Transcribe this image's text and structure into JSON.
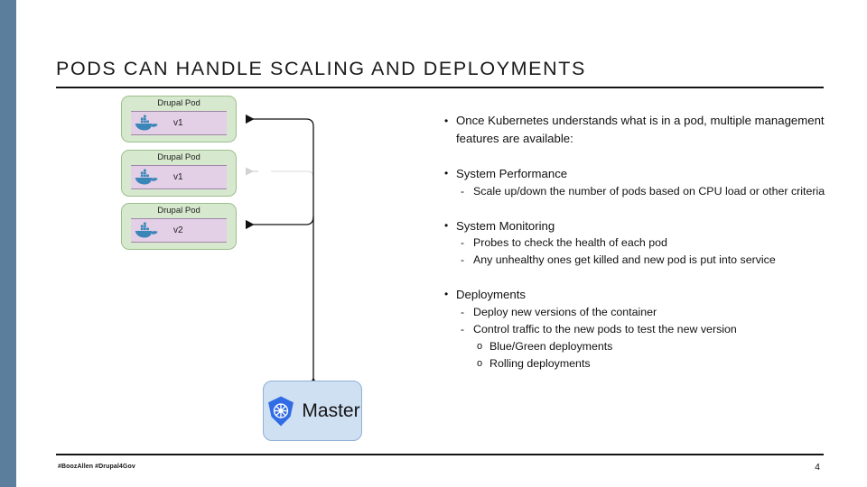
{
  "slide": {
    "title": "PODS CAN HANDLE SCALING AND DEPLOYMENTS",
    "accent_color": "#5b7e9c",
    "page_number": "4",
    "footer": "#BoozAllen #Drupal4Gov"
  },
  "diagram": {
    "pods": [
      {
        "title": "Drupal Pod",
        "version": "v1",
        "icon": "docker-whale-icon"
      },
      {
        "title": "Drupal Pod",
        "version": "v1",
        "icon": "docker-whale-icon"
      },
      {
        "title": "Drupal Pod",
        "version": "v2",
        "icon": "docker-whale-icon"
      }
    ],
    "master": {
      "label": "Master",
      "icon": "kubernetes-icon",
      "fill": "#cfe0f3"
    },
    "pod_fill": "#d6e8cd",
    "container_fill": "#e3cfe6"
  },
  "content": {
    "lead": "Once Kubernetes understands what is in a pod, multiple management features are available:",
    "sections": [
      {
        "heading": "System Performance",
        "items": [
          {
            "text": "Scale up/down the number of pods based on CPU load or other criteria",
            "subitems": []
          }
        ]
      },
      {
        "heading": "System Monitoring",
        "items": [
          {
            "text": "Probes to check the health of each pod",
            "subitems": []
          },
          {
            "text": "Any unhealthy ones get killed and new pod is put into service",
            "subitems": []
          }
        ]
      },
      {
        "heading": "Deployments",
        "items": [
          {
            "text": "Deploy new versions of the container",
            "subitems": []
          },
          {
            "text": "Control traffic to the new pods to test the new version",
            "subitems": [
              "Blue/Green deployments",
              "Rolling deployments"
            ]
          }
        ]
      }
    ],
    "markers": {
      "level1": "•",
      "level2": "-",
      "level3": "o"
    }
  }
}
